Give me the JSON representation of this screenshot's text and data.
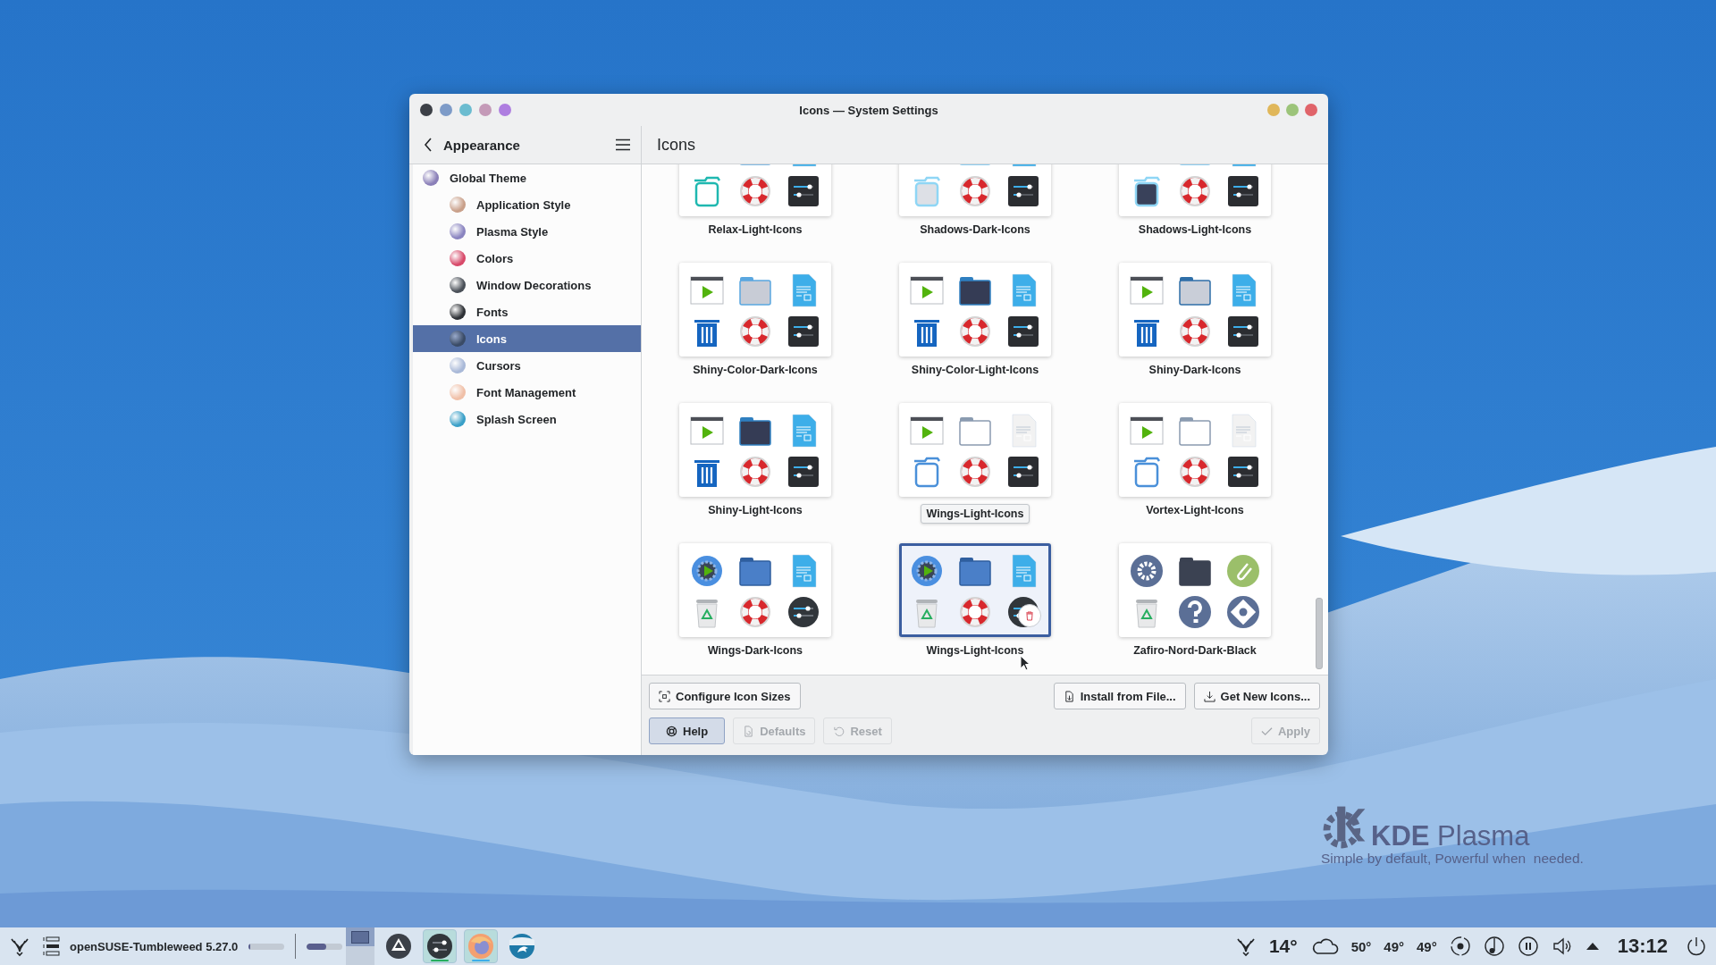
{
  "window": {
    "title": "Icons — System Settings"
  },
  "sidebar": {
    "back_label": "Appearance",
    "items": [
      {
        "label": "Global Theme",
        "selected": false,
        "children": [
          {
            "label": "Application Style",
            "selected": false
          },
          {
            "label": "Plasma Style",
            "selected": false
          },
          {
            "label": "Colors",
            "selected": false
          },
          {
            "label": "Window Decorations",
            "selected": false
          },
          {
            "label": "Fonts",
            "selected": false
          },
          {
            "label": "Icons",
            "selected": true
          },
          {
            "label": "Cursors",
            "selected": false
          },
          {
            "label": "Font Management",
            "selected": false
          },
          {
            "label": "Splash Screen",
            "selected": false
          }
        ]
      }
    ]
  },
  "page": {
    "title": "Icons"
  },
  "themes": [
    {
      "name": "Relax-Light-Icons",
      "selected": false
    },
    {
      "name": "Shadows-Dark-Icons",
      "selected": false
    },
    {
      "name": "Shadows-Light-Icons",
      "selected": false
    },
    {
      "name": "Shiny-Color-Dark-Icons",
      "selected": false
    },
    {
      "name": "Shiny-Color-Light-Icons",
      "selected": false
    },
    {
      "name": "Shiny-Dark-Icons",
      "selected": false
    },
    {
      "name": "Shiny-Light-Icons",
      "selected": false
    },
    {
      "tooltip": "Wings-Light-Icons",
      "selected": false
    },
    {
      "name": "Vortex-Light-Icons",
      "selected": false
    },
    {
      "name": "Wings-Dark-Icons",
      "selected": false
    },
    {
      "name": "Wings-Light-Icons",
      "selected": true
    },
    {
      "name": "Zafiro-Nord-Dark-Black",
      "selected": false
    }
  ],
  "buttons_top": [
    {
      "kind": "configure",
      "label": "Configure Icon Sizes",
      "disabled": false,
      "focused": false
    },
    {
      "kind": "install",
      "label": "Install from File...",
      "disabled": false,
      "focused": false
    },
    {
      "kind": "download",
      "label": "Get New Icons...",
      "disabled": false,
      "focused": false
    }
  ],
  "buttons_bottom": [
    {
      "kind": "help",
      "label": "Help",
      "disabled": false,
      "focused": true
    },
    {
      "kind": "defaults",
      "label": "Defaults",
      "disabled": true,
      "focused": false
    },
    {
      "kind": "reset",
      "label": "Reset",
      "disabled": true,
      "focused": false
    },
    {
      "kind": "apply",
      "label": "Apply",
      "disabled": true,
      "focused": false
    }
  ],
  "wallpaper_logo": {
    "title": "**KDE** Plasma",
    "tagline": "Simple by default, Powerful when  needed."
  },
  "taskbar": {
    "launcher_label": "openSUSE-Tumbleweed 5.27.0",
    "meters": [
      {
        "level": 0.03
      },
      {
        "level": 0.55
      }
    ],
    "desktops": [
      {
        "selected": true
      },
      {
        "selected": false
      }
    ],
    "tasks": [
      {
        "kind": "mountain",
        "active": false
      },
      {
        "kind": "settings",
        "active": true
      },
      {
        "kind": "browser",
        "active": true
      },
      {
        "kind": "dolphin",
        "active": false
      }
    ],
    "weather": "14°",
    "temperatures": [
      "50°",
      "49°",
      "49°"
    ],
    "clock": "13:12"
  }
}
